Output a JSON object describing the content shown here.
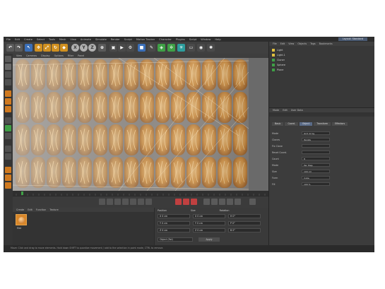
{
  "menubar": {
    "items": [
      "File",
      "Edit",
      "Create",
      "Select",
      "Tools",
      "Mesh",
      "View",
      "Animate",
      "Simulate",
      "Render",
      "Sculpt",
      "Motion Tracker",
      "Character",
      "Plugins",
      "Script",
      "Window",
      "Help"
    ],
    "layout_label": "Layout:",
    "layout_value": "Standard"
  },
  "viewport": {
    "menu": [
      "View",
      "Cameras",
      "Display",
      "Options",
      "Filter",
      "Panel"
    ],
    "label": "Perspective"
  },
  "material_manager": {
    "menu": [
      "Create",
      "Edit",
      "Function",
      "Texture"
    ],
    "material_name": "Mat"
  },
  "coordinates": {
    "headers": [
      "Position",
      "Size",
      "Rotation"
    ],
    "rows": [
      {
        "axis": "X",
        "pos": "0 cm",
        "size": "0 cm",
        "rot": "H 0°"
      },
      {
        "axis": "Y",
        "pos": "0 cm",
        "size": "0 cm",
        "rot": "P 0°"
      },
      {
        "axis": "Z",
        "pos": "0 cm",
        "size": "0 cm",
        "rot": "B 0°"
      }
    ],
    "mode": "Object (Rel)",
    "apply": "Apply"
  },
  "object_manager": {
    "menu": [
      "File",
      "Edit",
      "View",
      "Objects",
      "Tags",
      "Bookmarks"
    ],
    "objects": [
      "Light",
      "Light.1",
      "Cloner",
      "Sphere",
      "Plane"
    ]
  },
  "attribute_manager": {
    "menu": [
      "Mode",
      "Edit",
      "User Data"
    ],
    "tabs": [
      "Basic",
      "Coord.",
      "Object",
      "Transform",
      "Effectors"
    ],
    "active_tab": "Object",
    "rows": [
      {
        "label": "Mode",
        "value": "Grid Array"
      },
      {
        "label": "Clones",
        "value": "Iterate"
      },
      {
        "label": "Fix Clone",
        "value": ""
      },
      {
        "label": "Reset Coord.",
        "value": ""
      },
      {
        "label": "Count",
        "value": "8"
      },
      {
        "label": "Mode",
        "value": "Per Step"
      },
      {
        "label": "Size",
        "value": "100 cm"
      },
      {
        "label": "Form",
        "value": "Cube"
      },
      {
        "label": "Fill",
        "value": "100 %"
      }
    ]
  },
  "status": {
    "text": "Move: Click and drag to move elements. Hold down SHIFT to quantize movement / add to the selection in point mode, CTRL to remove."
  },
  "colors": {
    "accent": "#f0a030",
    "selection": "#5a6b88",
    "viewport_bg": "#8c8c8c"
  }
}
